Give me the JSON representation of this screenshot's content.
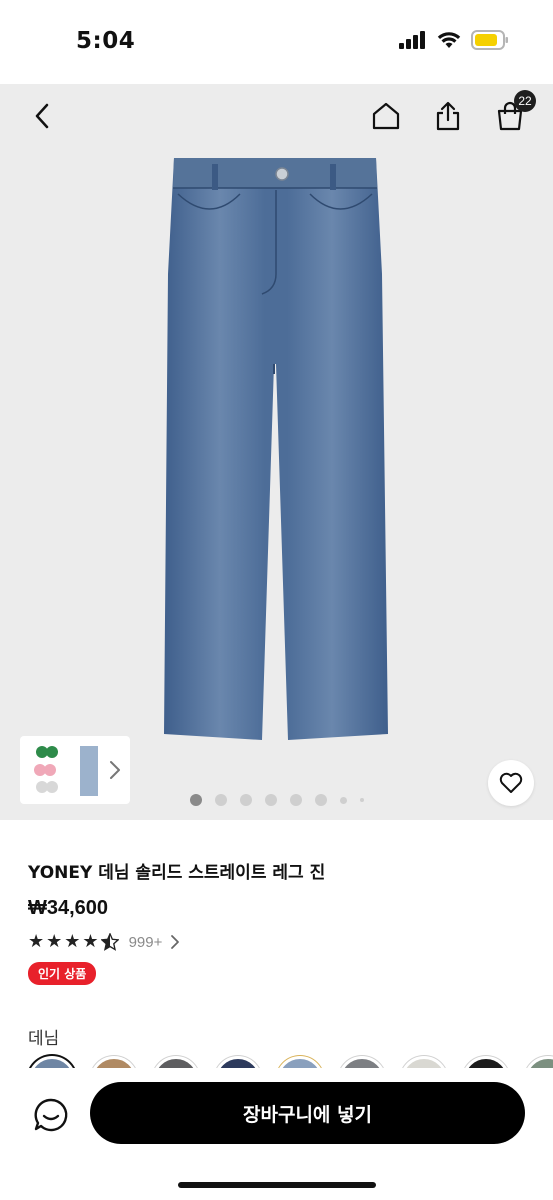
{
  "status_bar": {
    "time": "5:04"
  },
  "top_nav": {
    "cart_count": "22"
  },
  "gallery": {
    "image_count": 8,
    "active_index": 0
  },
  "product": {
    "title": "YONEY 데님 솔리드 스트레이트 레그 진",
    "price": "₩34,600",
    "rating": 4.5,
    "review_count": "999+",
    "badge": "인기 상품"
  },
  "color_section": {
    "label": "데님",
    "swatches": [
      "#6f86a4",
      "#b08a63",
      "#5e5e60",
      "#2d3a5c",
      "#8aa0bd",
      "#7d7f83",
      "#d9d8d2",
      "#1c1c1c",
      "#7c9080"
    ]
  },
  "bottom_bar": {
    "cart_button_label": "장바구니에 넣기"
  },
  "colors": {
    "badge_red": "#e8212b",
    "button_black": "#000000",
    "battery_yellow": "#f5d000"
  }
}
